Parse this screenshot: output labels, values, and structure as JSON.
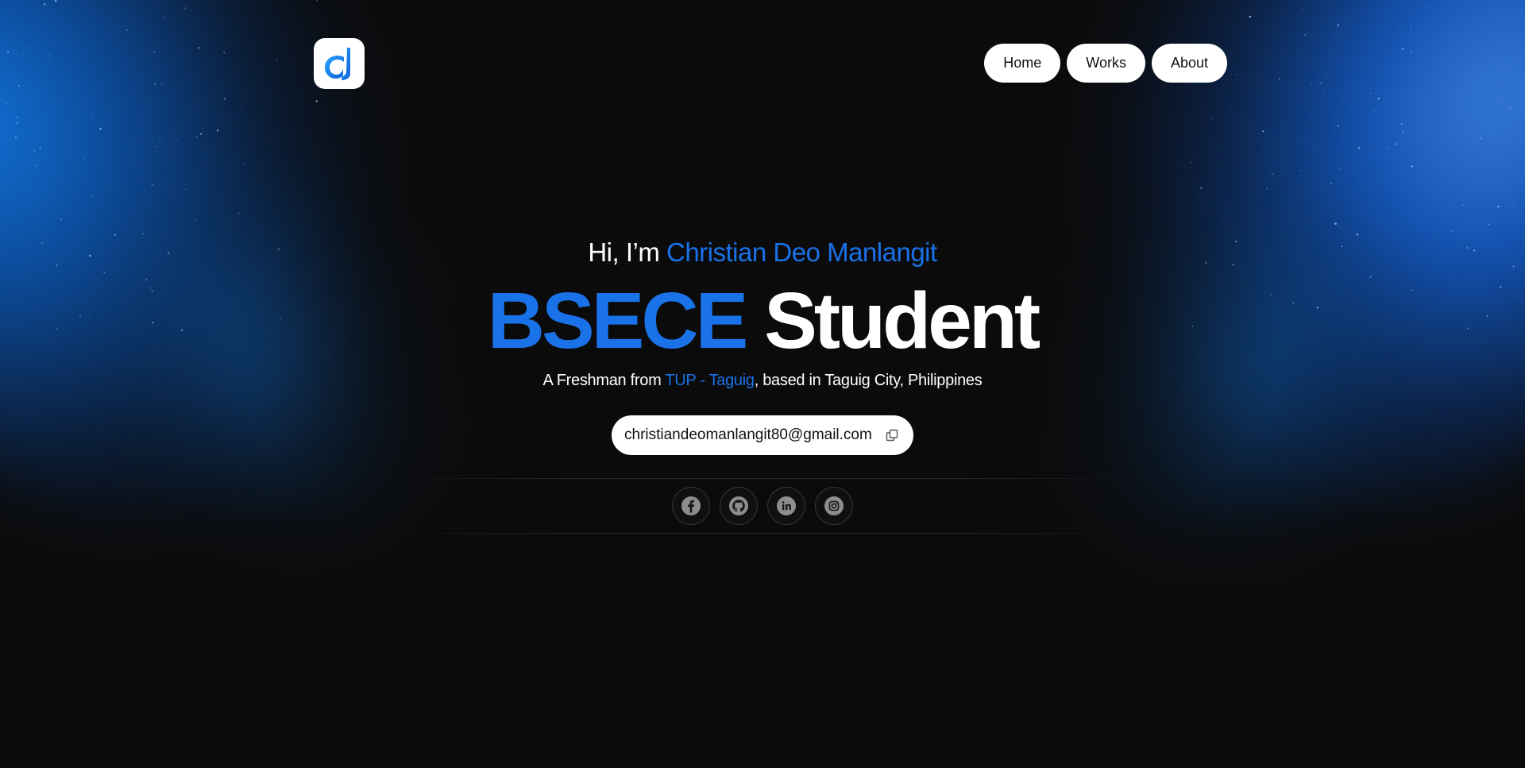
{
  "brand": {
    "logo_icon": "d-letter-logo-icon",
    "accent_color": "#1a72e8"
  },
  "nav": {
    "items": [
      {
        "label": "Home"
      },
      {
        "label": "Works"
      },
      {
        "label": "About"
      }
    ]
  },
  "hero": {
    "greeting_prefix": "Hi, I’m ",
    "name": "Christian Deo Manlangit",
    "headline_accent": "BSECE",
    "headline_rest": " Student",
    "sub_prefix": "A Freshman from ",
    "school": "TUP - Taguig",
    "sub_suffix": ", based in Taguig City, Philippines"
  },
  "contact": {
    "email": "christiandeomanlangit80@gmail.com",
    "copy_icon": "copy-icon"
  },
  "socials": [
    {
      "icon": "facebook-icon"
    },
    {
      "icon": "github-icon"
    },
    {
      "icon": "linkedin-icon"
    },
    {
      "icon": "instagram-icon"
    }
  ]
}
